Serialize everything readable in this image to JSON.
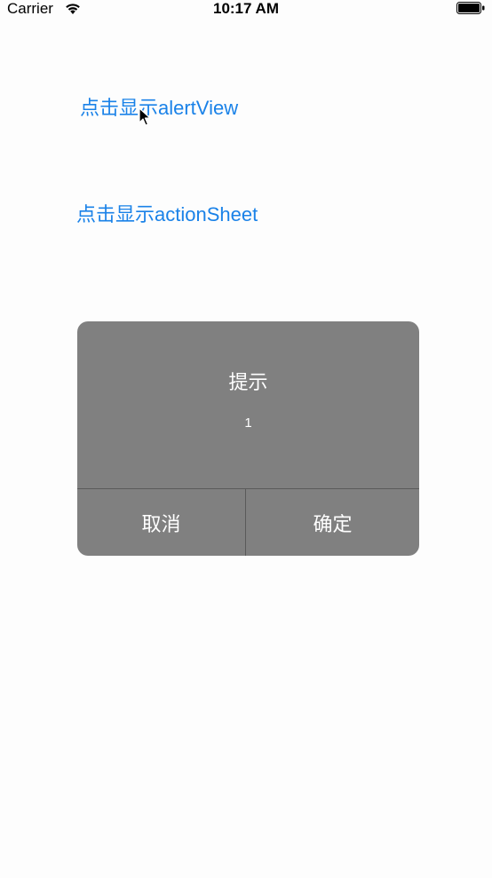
{
  "status_bar": {
    "carrier": "Carrier",
    "time": "10:17 AM",
    "wifi_icon": "wifi-icon",
    "battery_icon": "battery-icon"
  },
  "buttons": {
    "alert_view": "点击显示alertView",
    "action_sheet": "点击显示actionSheet"
  },
  "alert": {
    "title": "提示",
    "message": "1",
    "cancel": "取消",
    "confirm": "确定"
  },
  "colors": {
    "link": "#1a82e8",
    "alert_bg": "#808080",
    "background": "#fdfdfd"
  }
}
